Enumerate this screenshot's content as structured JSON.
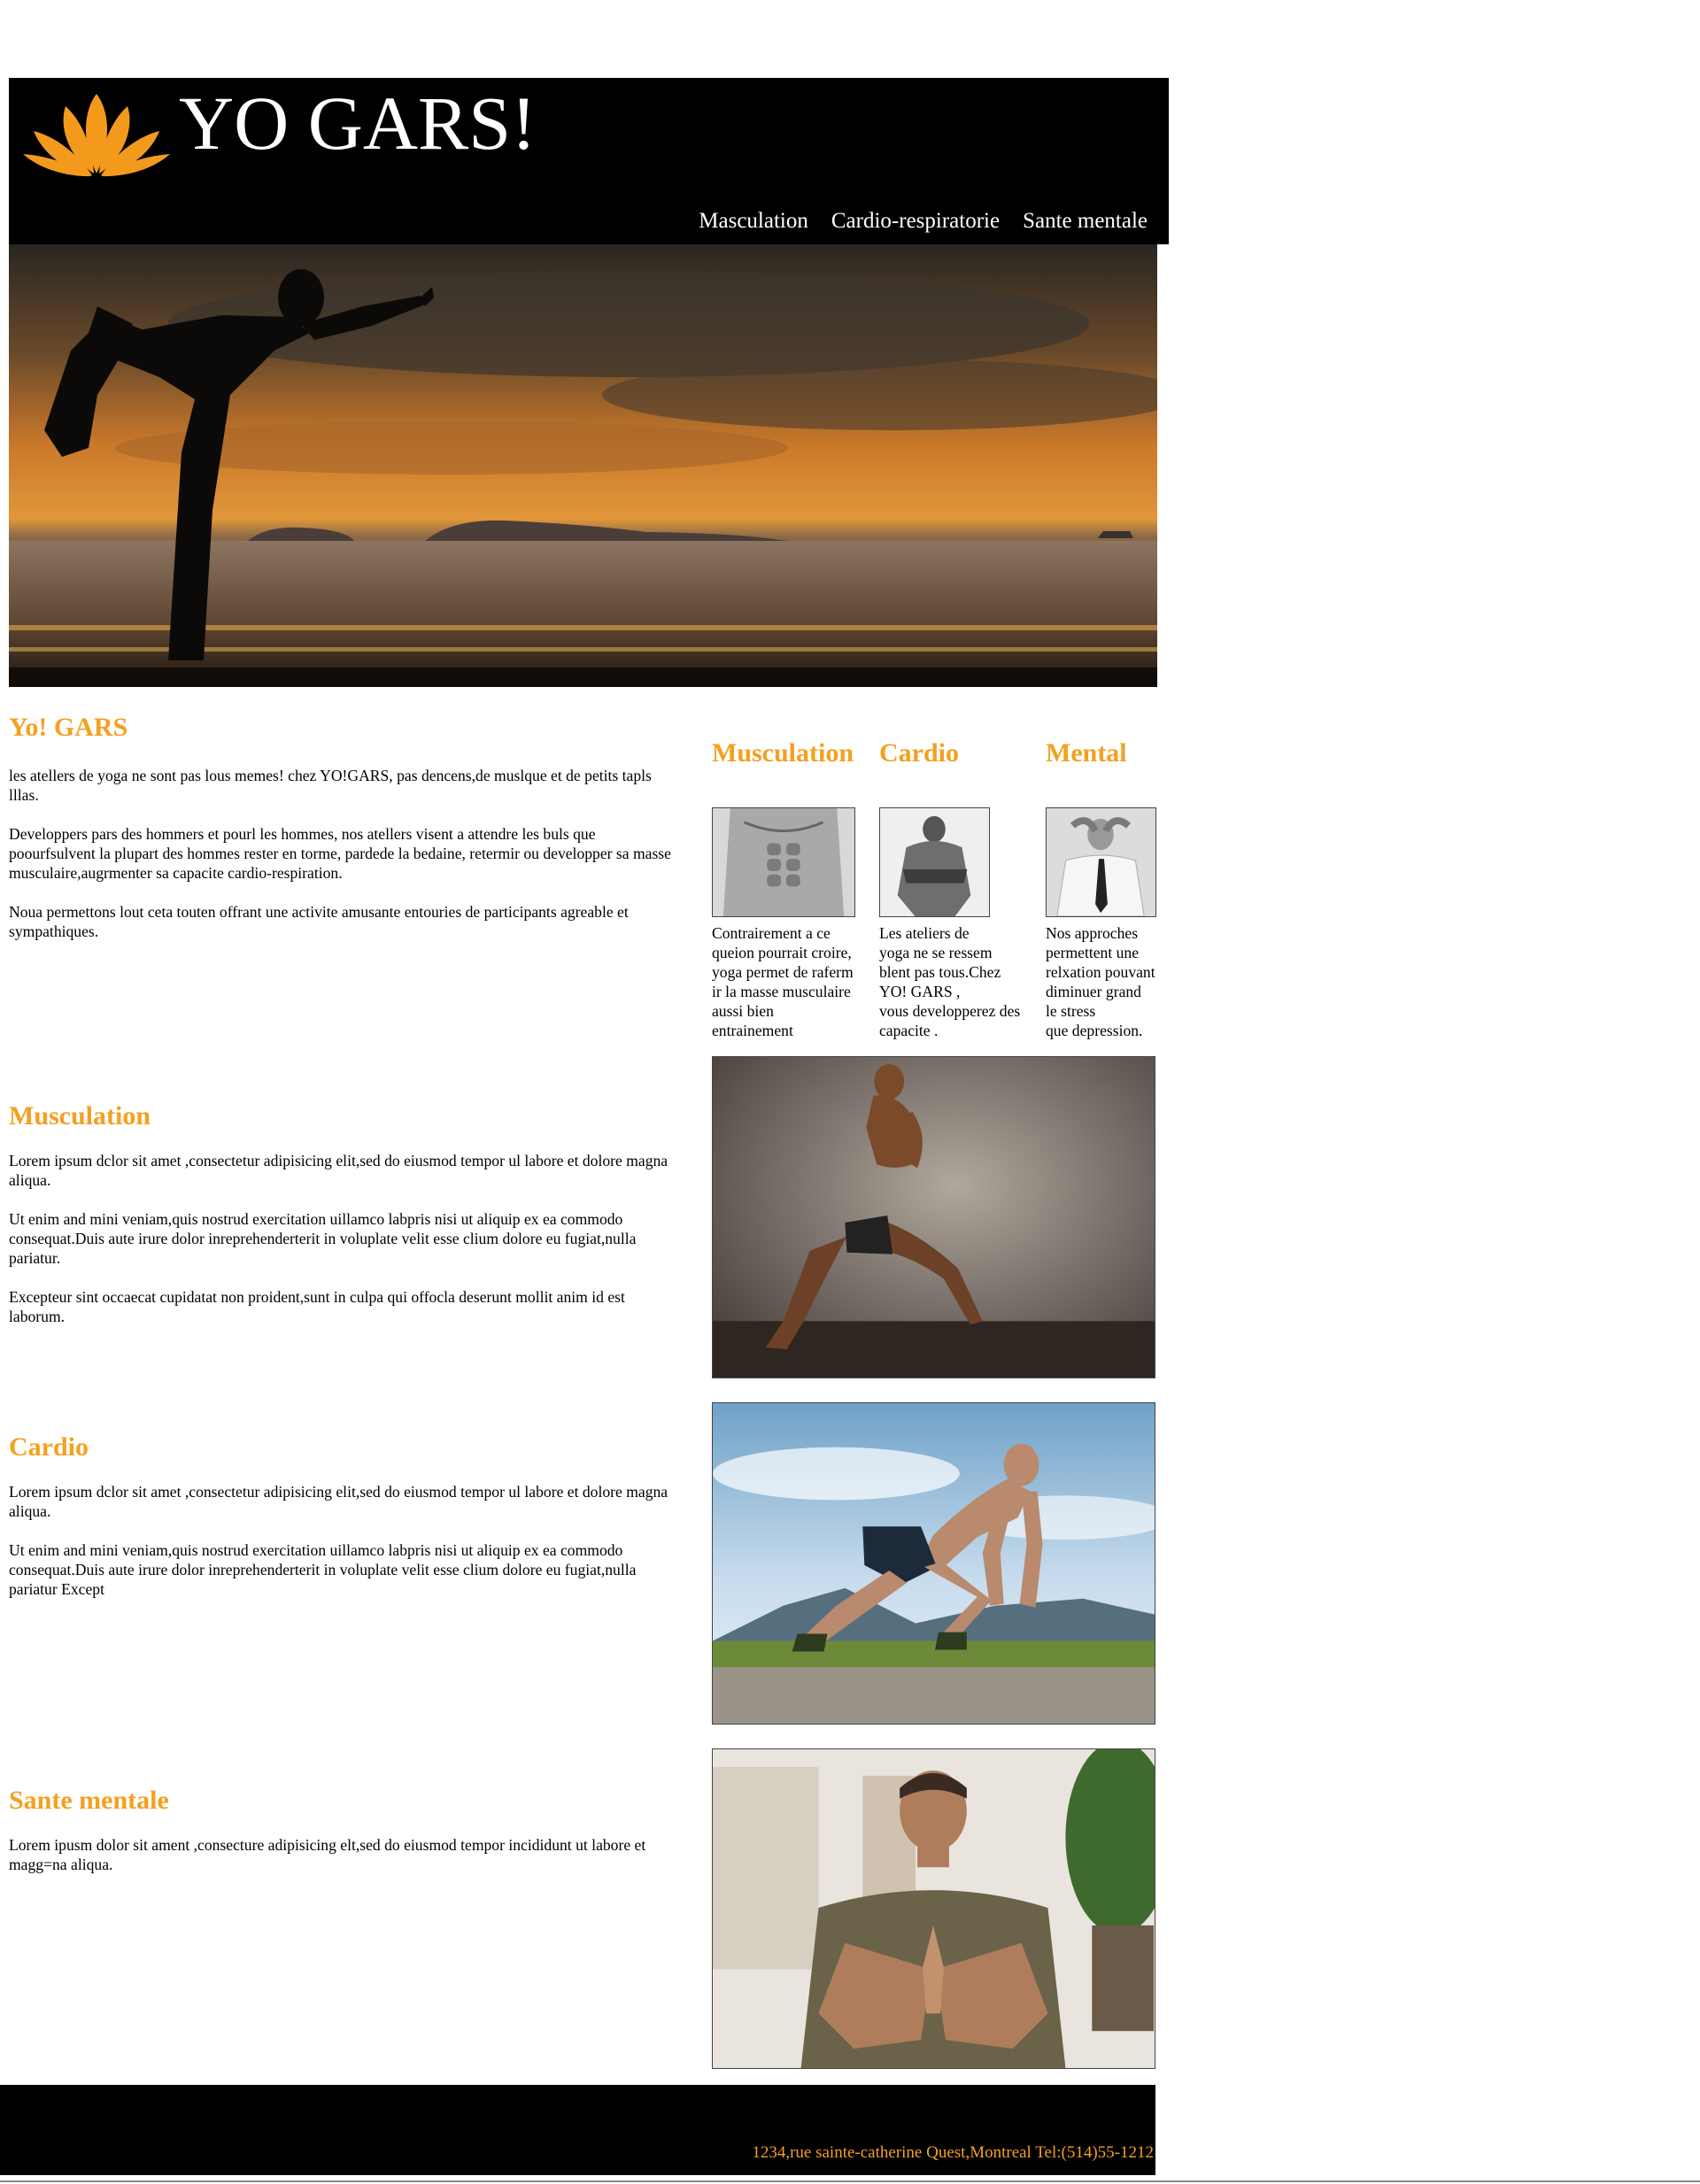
{
  "header": {
    "title": "YO GARS!",
    "nav": [
      "Masculation",
      "Cardio-respiratorie",
      "Sante mentale"
    ]
  },
  "intro": {
    "heading": "Yo! GARS",
    "paragraphs": [
      "les atellers de yoga ne sont pas lous memes! chez YO!GARS, pas dencens,de muslque et de petits tapls lllas.",
      "Developpers pars des hommers et pourl les hommes, nos atellers visent a attendre les buls que poourfsulvent la plupart des hommes rester en torme, pardede la bedaine, retermir ou developper sa masse musculaire,augrmenter sa capacite cardio-respiration.",
      "Noua permettons lout ceta touten offrant une activite amusante entouries de participants agreable et sympathiques."
    ]
  },
  "features": [
    {
      "title": "Musculation",
      "text": "Contrairement a ce\nqueion pourrait croire,\nyoga permet de raferm\nir la masse musculaire\naussi bien\nentrainement"
    },
    {
      "title": "Cardio",
      "text": "Les ateliers de\nyoga ne se ressem\nblent pas tous.Chez\nYO! GARS ,\nvous developperez des\ncapacite ."
    },
    {
      "title": "Mental",
      "text": "Nos approches\npermettent une\nrelxation pouvant\ndiminuer grand\nle stress\nque depression."
    }
  ],
  "sections": [
    {
      "heading": "Musculation",
      "paragraphs": [
        "Lorem ipsum dclor sit amet ,consectetur adipisicing elit,sed do eiusmod tempor ul labore et dolore magna aliqua.",
        "Ut enim and mini veniam,quis nostrud exercitation uillamco labpris nisi ut aliquip ex ea commodo consequat.Duis aute irure dolor inreprehenderterit in voluplate velit esse clium dolore eu fugiat,nulla pariatur.",
        "Excepteur sint occaecat cupidatat non proident,sunt in culpa qui offocla deserunt mollit anim id est laborum."
      ]
    },
    {
      "heading": "Cardio",
      "paragraphs": [
        "Lorem ipsum dclor sit amet ,consectetur adipisicing elit,sed do eiusmod tempor ul labore et dolore magna aliqua.",
        "Ut enim and mini veniam,quis nostrud exercitation uillamco labpris nisi ut aliquip ex ea commodo consequat.Duis aute irure dolor inreprehenderterit in voluplate velit esse clium dolore eu fugiat,nulla pariatur Except"
      ]
    },
    {
      "heading": "Sante mentale",
      "paragraphs": [
        "Lorem ipusm dolor sit ament ,consecture adipisicing elt,sed do eiusmod tempor incididunt ut labore et magg=na aliqua."
      ]
    }
  ],
  "footer": {
    "text": "1234,rue sainte-catherine Quest,Montreal  Tel:(514)55-1212"
  },
  "colors": {
    "accent": "#f4a020",
    "header_bg": "#000000",
    "footer_bg": "#000000"
  }
}
